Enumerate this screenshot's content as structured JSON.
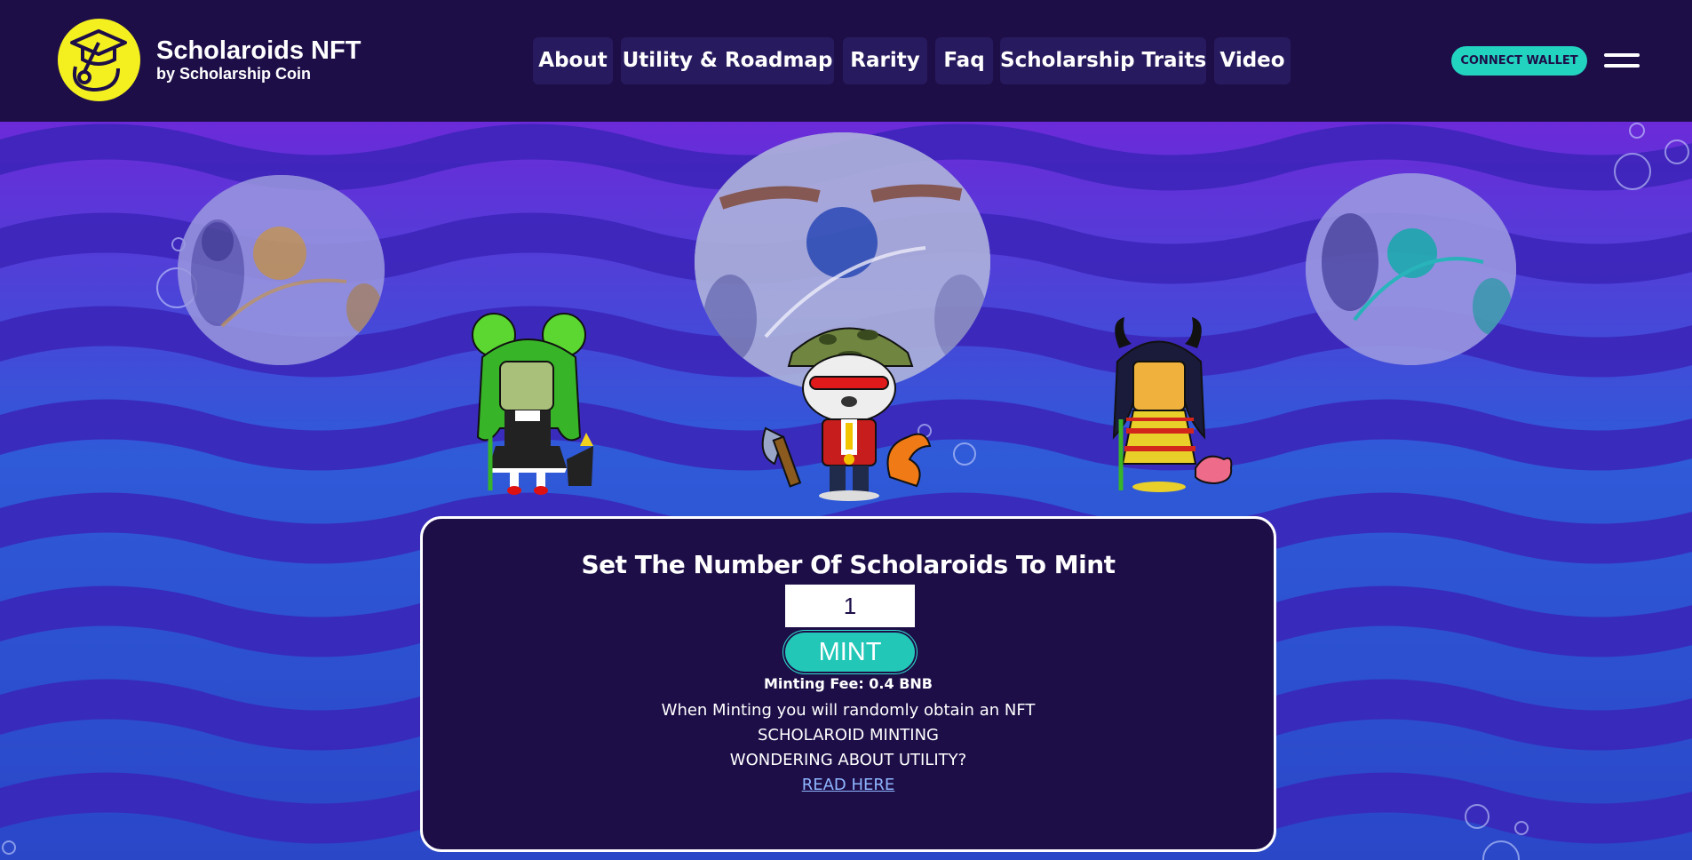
{
  "brand": {
    "title": "Scholaroids NFT",
    "subtitle": "by Scholarship Coin",
    "logo_icon": "graduation-cap-icon",
    "logo_color": "#f4ef1f"
  },
  "nav": {
    "items": [
      {
        "label": "About"
      },
      {
        "label": "Utility & Roadmap"
      },
      {
        "label": "Rarity"
      },
      {
        "label": "Faq"
      },
      {
        "label": "Scholarship Traits"
      },
      {
        "label": "Video"
      }
    ]
  },
  "header_actions": {
    "connect_wallet_label": "CONNECT WALLET",
    "menu_icon": "hamburger-menu-icon"
  },
  "mint": {
    "title": "Set The Number Of Scholaroids To Mint",
    "quantity": "1",
    "mint_label": "MINT",
    "fee_text": "Minting Fee: 0.4 BNB",
    "line1": "When Minting you will randomly obtain an NFT",
    "line2": "SCHOLAROID MINTING",
    "line3": "WONDERING ABOUT UTILITY?",
    "link_label": "READ HERE"
  },
  "colors": {
    "header_bg": "#1d0e48",
    "accent": "#22d3c0",
    "wave_light": "#2f63d9",
    "wave_dark": "#3a1fb5"
  }
}
